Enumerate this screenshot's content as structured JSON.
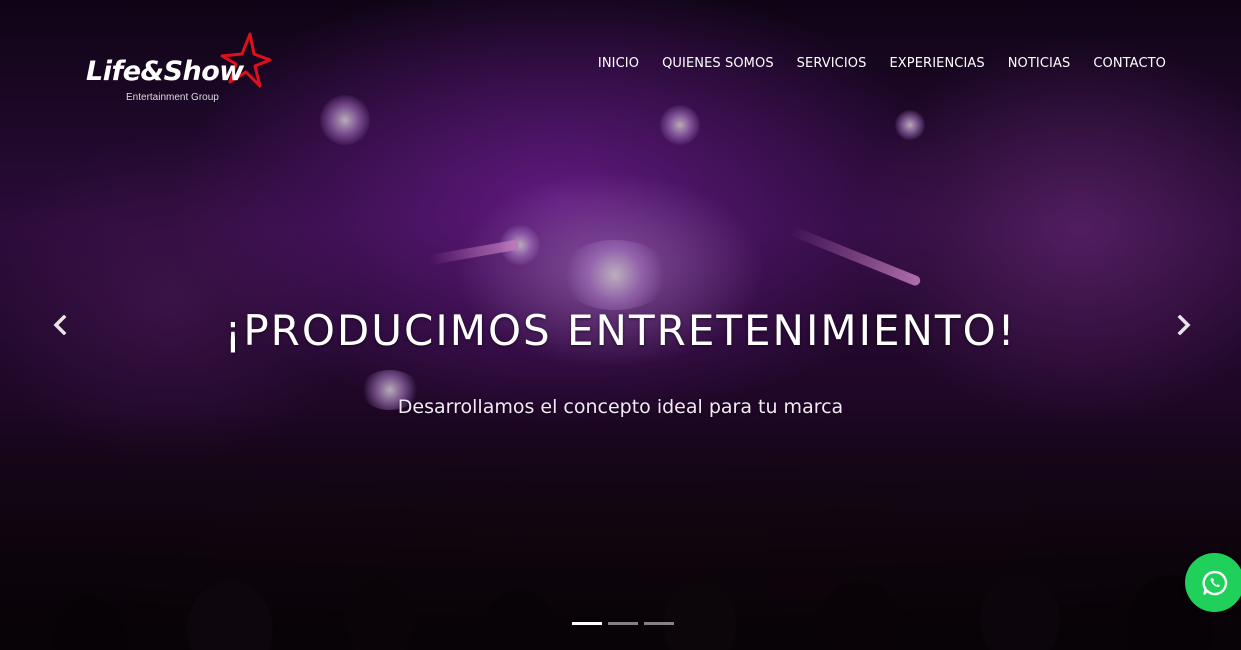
{
  "brand": {
    "name": "Life&Show",
    "tagline": "Entertainment Group",
    "star_color": "#e0101a"
  },
  "nav": {
    "items": [
      {
        "label": "INICIO"
      },
      {
        "label": "QUIENES SOMOS"
      },
      {
        "label": "SERVICIOS"
      },
      {
        "label": "EXPERIENCIAS"
      },
      {
        "label": "NOTICIAS"
      },
      {
        "label": "CONTACTO"
      }
    ]
  },
  "hero": {
    "headline": "¡PRODUCIMOS ENTRETENIMIENTO!",
    "subheadline": "Desarrollamos el concepto ideal para tu marca",
    "prev_icon": "chevron-left-icon",
    "next_icon": "chevron-right-icon",
    "slide_count": 3,
    "active_slide": 1
  },
  "whatsapp": {
    "icon": "whatsapp-icon",
    "color": "#1fd15a"
  }
}
